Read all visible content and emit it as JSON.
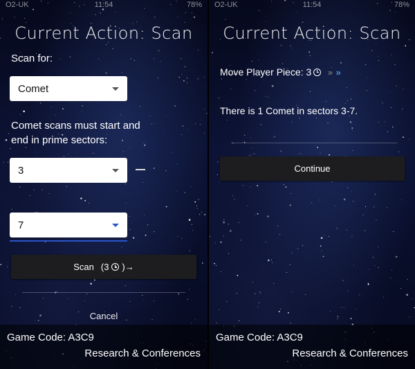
{
  "status": {
    "carrier": "O2-UK",
    "time": "11:54",
    "battery": "78%"
  },
  "left": {
    "title": "Current Action: Scan",
    "scan_for_label": "Scan for:",
    "scan_for_value": "Comet",
    "rule_text_line1": "Comet scans must start and",
    "rule_text_line2": "end in prime sectors:",
    "start_sector": "3",
    "end_sector": "7",
    "scan_button_label": "Scan",
    "scan_cost": "(3",
    "scan_arrow": ")→",
    "cancel_label": "Cancel"
  },
  "right": {
    "title": "Current Action: Scan",
    "move_label": "Move Player Piece: 3",
    "chevrons_dim": "››››",
    "chevrons_hi": "»",
    "result_text": "There is 1 Comet in sectors 3-7.",
    "continue_label": "Continue"
  },
  "footer": {
    "game_code": "Game Code: A3C9",
    "section": "Research & Conferences"
  },
  "colors": {
    "accent_blue": "#2a55c8",
    "chevron_highlight": "#4d8fd6",
    "button_bg": "#1d1d1f"
  }
}
